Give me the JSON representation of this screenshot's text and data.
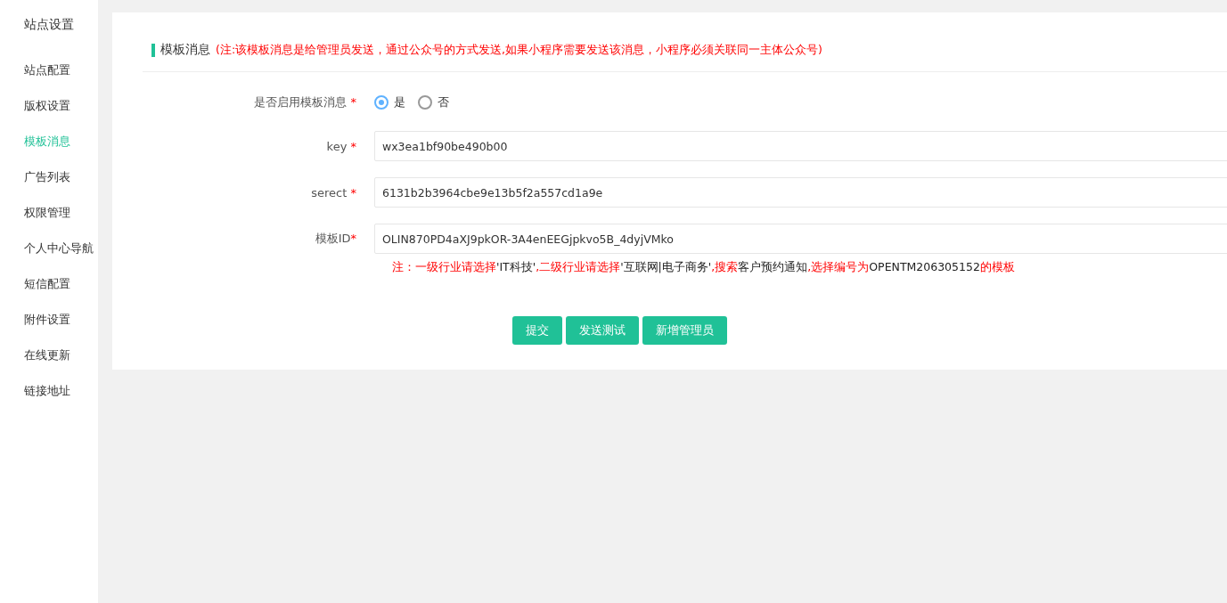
{
  "sidebar": {
    "title": "站点设置",
    "items": [
      {
        "label": "站点配置",
        "selected": false
      },
      {
        "label": "版权设置",
        "selected": false
      },
      {
        "label": "模板消息",
        "selected": true
      },
      {
        "label": "广告列表",
        "selected": false
      },
      {
        "label": "权限管理",
        "selected": false
      },
      {
        "label": "个人中心导航",
        "selected": false
      },
      {
        "label": "短信配置",
        "selected": false
      },
      {
        "label": "附件设置",
        "selected": false
      },
      {
        "label": "在线更新",
        "selected": false
      },
      {
        "label": "链接地址",
        "selected": false
      }
    ]
  },
  "section": {
    "title": "模板消息",
    "note": "(注:该模板消息是给管理员发送，通过公众号的方式发送,如果小程序需要发送该消息，小程序必须关联同一主体公众号)"
  },
  "form": {
    "fields": [
      {
        "kind": "radio",
        "label": "是否启用模板消息",
        "required_mark": "*",
        "options": [
          {
            "label": "是",
            "selected": true
          },
          {
            "label": "否",
            "selected": false
          }
        ]
      },
      {
        "kind": "text",
        "label": "key",
        "required_mark": "*",
        "value": "wx3ea1bf90be490b00"
      },
      {
        "kind": "text",
        "label": "serect",
        "required_mark": "*",
        "value": "6131b2b3964cbe9e13b5f2a557cd1a9e"
      },
      {
        "kind": "text",
        "label": "模板ID",
        "required_mark": "*",
        "value": "OLIN870PD4aXJ9pkOR-3A4enEEGjpkvo5B_4dyjVMko"
      }
    ],
    "hint": [
      {
        "kind": "note",
        "text": "注：一级行业请选择"
      },
      {
        "kind": "value",
        "text": "'IT科技'"
      },
      {
        "kind": "note",
        "text": ",二级行业请选择"
      },
      {
        "kind": "value",
        "text": "'互联网|电子商务'"
      },
      {
        "kind": "note",
        "text": ",搜索"
      },
      {
        "kind": "value",
        "text": "客户预约通知"
      },
      {
        "kind": "note",
        "text": ",选择编号为"
      },
      {
        "kind": "value",
        "text": "OPENTM206305152"
      },
      {
        "kind": "note",
        "text": "的模板"
      }
    ]
  },
  "buttons": [
    "提交",
    "发送测试",
    "新增管理员"
  ]
}
